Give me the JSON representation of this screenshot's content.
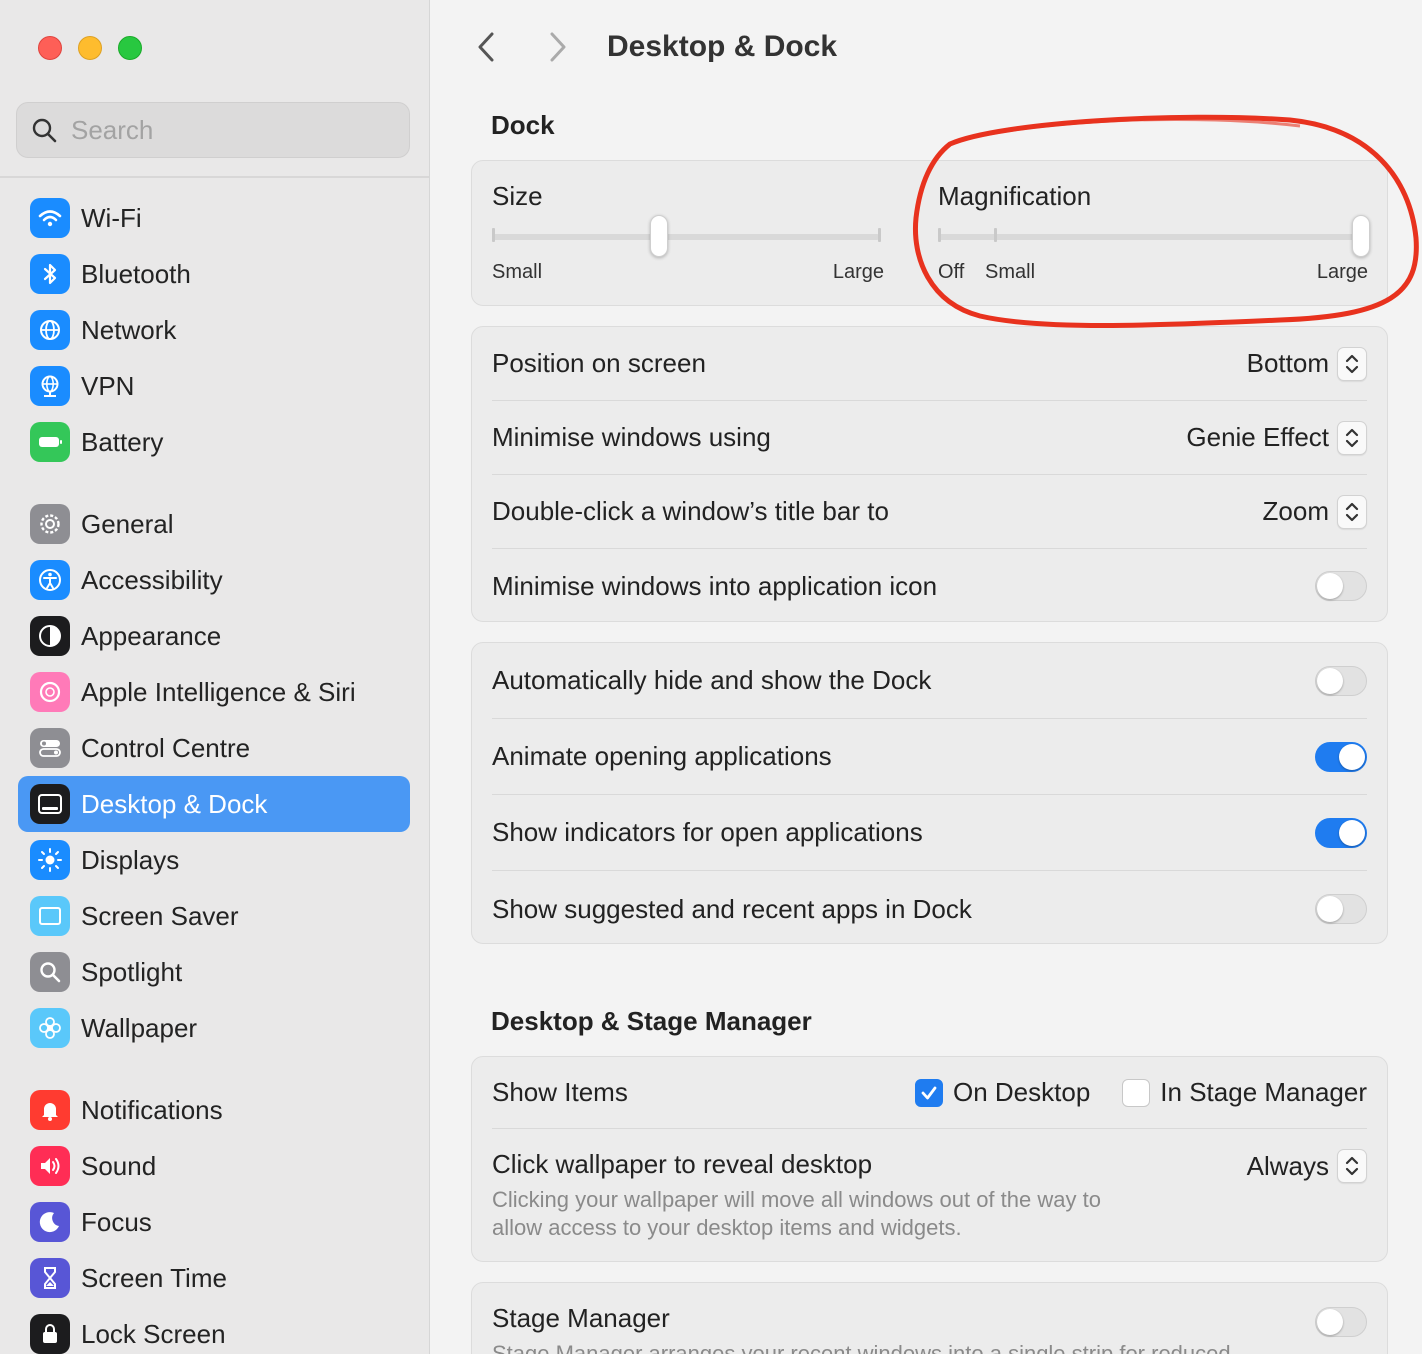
{
  "window": {
    "title": "Desktop & Dock"
  },
  "search": {
    "placeholder": "Search"
  },
  "sidebar": {
    "groups": [
      [
        {
          "label": "Wi-Fi",
          "icon": "wifi-icon",
          "color": "#1a8cff"
        },
        {
          "label": "Bluetooth",
          "icon": "bluetooth-icon",
          "color": "#1a8cff"
        },
        {
          "label": "Network",
          "icon": "globe-icon",
          "color": "#1a8cff"
        },
        {
          "label": "VPN",
          "icon": "vpn-globe-icon",
          "color": "#1a8cff"
        },
        {
          "label": "Battery",
          "icon": "battery-icon",
          "color": "#34c759"
        }
      ],
      [
        {
          "label": "General",
          "icon": "gear-icon",
          "color": "#8e8e93"
        },
        {
          "label": "Accessibility",
          "icon": "accessibility-icon",
          "color": "#1a8cff"
        },
        {
          "label": "Appearance",
          "icon": "appearance-icon",
          "color": "#1c1c1e"
        },
        {
          "label": "Apple Intelligence & Siri",
          "icon": "siri-icon",
          "color": "#ff7ab8"
        },
        {
          "label": "Control Centre",
          "icon": "control-centre-icon",
          "color": "#8e8e93"
        },
        {
          "label": "Desktop & Dock",
          "icon": "dock-icon",
          "color": "#1c1c1e"
        },
        {
          "label": "Displays",
          "icon": "sun-icon",
          "color": "#1a8cff"
        },
        {
          "label": "Screen Saver",
          "icon": "screen-saver-icon",
          "color": "#5ac8fa"
        },
        {
          "label": "Spotlight",
          "icon": "magnifier-icon",
          "color": "#8e8e93"
        },
        {
          "label": "Wallpaper",
          "icon": "flower-icon",
          "color": "#5ac8fa"
        }
      ],
      [
        {
          "label": "Notifications",
          "icon": "bell-icon",
          "color": "#ff3b30"
        },
        {
          "label": "Sound",
          "icon": "speaker-icon",
          "color": "#ff2d55"
        },
        {
          "label": "Focus",
          "icon": "moon-icon",
          "color": "#5856d6"
        },
        {
          "label": "Screen Time",
          "icon": "hourglass-icon",
          "color": "#5856d6"
        },
        {
          "label": "Lock Screen",
          "icon": "lock-icon",
          "color": "#1c1c1e"
        }
      ]
    ],
    "active": "Desktop & Dock",
    "active_color": "#4a98f4"
  },
  "dock": {
    "section_title": "Dock",
    "size": {
      "label": "Size",
      "min_label": "Small",
      "max_label": "Large",
      "value_fraction": 0.43
    },
    "magnification": {
      "label": "Magnification",
      "off_label": "Off",
      "min_label": "Small",
      "max_label": "Large",
      "value_fraction": 1.0
    },
    "rows": [
      {
        "label": "Position on screen",
        "value": "Bottom"
      },
      {
        "label": "Minimise windows using",
        "value": "Genie Effect"
      },
      {
        "label": "Double-click a window’s title bar to",
        "value": "Zoom"
      },
      {
        "label": "Minimise windows into application icon",
        "toggle": false
      }
    ],
    "rows2": [
      {
        "label": "Automatically hide and show the Dock",
        "toggle": false
      },
      {
        "label": "Animate opening applications",
        "toggle": true
      },
      {
        "label": "Show indicators for open applications",
        "toggle": true
      },
      {
        "label": "Show suggested and recent apps in Dock",
        "toggle": false
      }
    ]
  },
  "desktop_stage": {
    "section_title": "Desktop & Stage Manager",
    "show_items": {
      "label": "Show Items",
      "on_desktop": "On Desktop",
      "on_desktop_checked": true,
      "in_stage_manager": "In Stage Manager",
      "in_stage_manager_checked": false
    },
    "click_wallpaper": {
      "label": "Click wallpaper to reveal desktop",
      "value": "Always",
      "description_line1": "Clicking your wallpaper will move all windows out of the way to",
      "description_line2": "allow access to your desktop items and widgets."
    },
    "stage_manager": {
      "label": "Stage Manager",
      "toggle": false,
      "description": "Stage Manager arranges your recent windows into a single strip for reduced"
    }
  },
  "colors": {
    "accent": "#1f7cf0",
    "annotation": "#e8321e"
  }
}
